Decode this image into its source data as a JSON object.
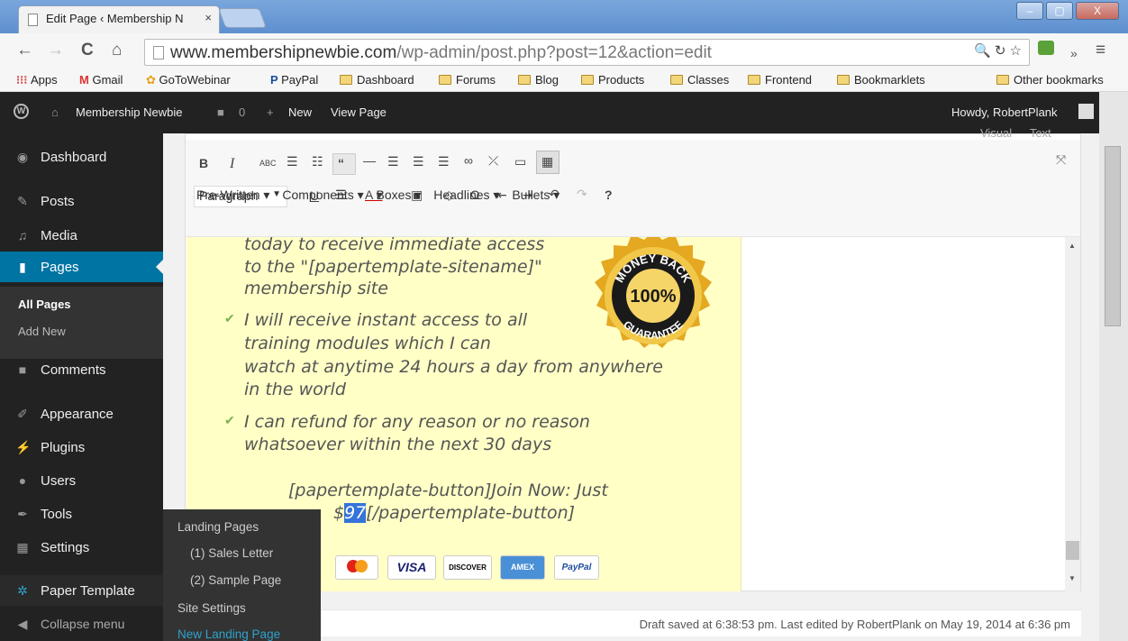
{
  "browser": {
    "tab_title": "Edit Page ‹ Membership N",
    "tab_close": "×",
    "url_host": "www.membershipnewbie.com",
    "url_path": "/wp-admin/post.php?post=12&action=edit",
    "window_minimize": "–",
    "window_maximize": "▢",
    "window_close": "X",
    "nav_back": "←",
    "nav_forward": "→",
    "nav_reload": "C",
    "nav_home": "⌂",
    "omni_icons": "🔍 ↻ ☆",
    "menu_icon": "≡",
    "overflow_icon": "»"
  },
  "bookmarks": {
    "apps": "Apps",
    "gmail": "Gmail",
    "gotowebinar": "GoToWebinar",
    "paypal": "PayPal",
    "folders": [
      "Dashboard",
      "Forums",
      "Blog",
      "Products",
      "Classes",
      "Frontend",
      "Bookmarklets"
    ],
    "other": "Other bookmarks"
  },
  "adminbar": {
    "site_name": "Membership Newbie",
    "comments_count": "0",
    "new_label": "New",
    "view_page": "View Page",
    "howdy": "Howdy, RobertPlank"
  },
  "sidebar": {
    "items": [
      {
        "label": "Dashboard",
        "icon": "dashboard-icon"
      },
      {
        "label": "Posts",
        "icon": "pin-icon"
      },
      {
        "label": "Media",
        "icon": "media-icon"
      },
      {
        "label": "Pages",
        "icon": "pages-icon"
      },
      {
        "label": "Comments",
        "icon": "comment-icon"
      },
      {
        "label": "Appearance",
        "icon": "brush-icon"
      },
      {
        "label": "Plugins",
        "icon": "plug-icon"
      },
      {
        "label": "Users",
        "icon": "users-icon"
      },
      {
        "label": "Tools",
        "icon": "wrench-icon"
      },
      {
        "label": "Settings",
        "icon": "settings-icon"
      },
      {
        "label": "Paper Template",
        "icon": "gear-icon"
      },
      {
        "label": "Collapse menu",
        "icon": "collapse-icon"
      }
    ],
    "submenu": [
      "All Pages",
      "Add New"
    ],
    "flyout": [
      "Landing Pages",
      "(1) Sales Letter",
      "(2) Sample Page",
      "Site Settings",
      "New Landing Page"
    ]
  },
  "editor": {
    "tab_visual": "Visual",
    "tab_text": "Text",
    "format_select": "Paragraph",
    "menus": [
      "Pre-Written ▾",
      "Components ▾",
      "Boxes ▾",
      "Headlines ▾",
      "Bullets ▾"
    ],
    "content_lines": [
      "today to receive immediate access",
      "to the \"[papertemplate-sitename]\"",
      "membership site",
      "I will receive instant access to all",
      "training modules which I can",
      "watch at anytime 24 hours a day from anywhere",
      "in the world",
      "I can refund for any reason or no reason",
      "whatsoever within the next 30 days"
    ],
    "button_line1": "[papertemplate-button]Join Now: Just",
    "button_price_prefix": "$",
    "button_price_selected": "97",
    "button_line2_rest": "[/papertemplate-button]",
    "badge_top": "MONEY BACK",
    "badge_pct": "100%",
    "badge_bottom": "GUARANTEE",
    "cards": [
      "VISA",
      "DISCOVER",
      "AMEX",
      "PayPal"
    ],
    "status": "Draft saved at 6:38:53 pm. Last edited by RobertPlank on May 19, 2014 at 6:36 pm"
  },
  "colors": {
    "admin_bar": "#222222",
    "active_menu": "#0074a2",
    "content_bg": "#ffffc6",
    "link": "#2ea2cc"
  }
}
